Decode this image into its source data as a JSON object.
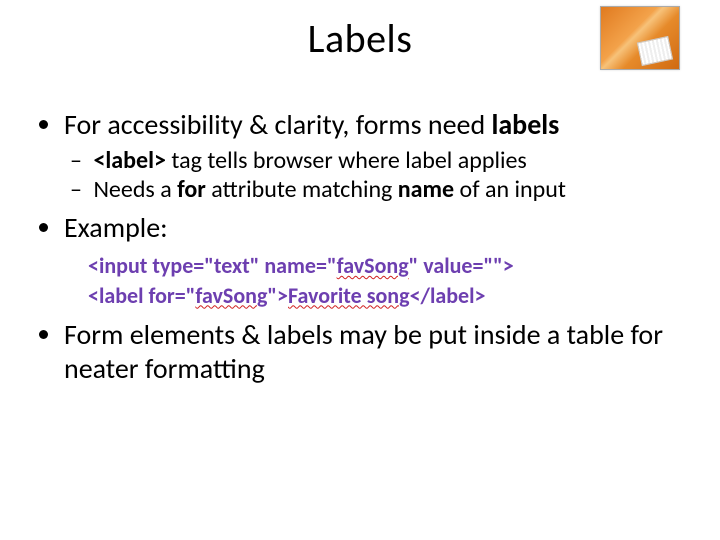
{
  "title": "Labels",
  "bullets": {
    "b1_prefix": "For accessibility & clarity, forms need ",
    "b1_bold": "labels",
    "b1a_dash_pre": "<label>",
    "b1a_rest": " tag tells browser where label applies",
    "b1b_pre": "Needs a ",
    "b1b_bold1": "for",
    "b1b_mid": " attribute matching ",
    "b1b_bold2": "name",
    "b1b_post": " of an input",
    "b2": "Example:",
    "b3": "Form elements & labels may be put inside a table for neater formatting"
  },
  "code": {
    "l1_a": "<input type=\"text\" name=\"",
    "l1_w1": "favSong",
    "l1_b": "\" value=\"\">",
    "l2_a": "<label for=\"",
    "l2_w1": "favSong",
    "l2_b": "\">",
    "l2_w2": "Favorite song",
    "l2_c": "</label>"
  }
}
